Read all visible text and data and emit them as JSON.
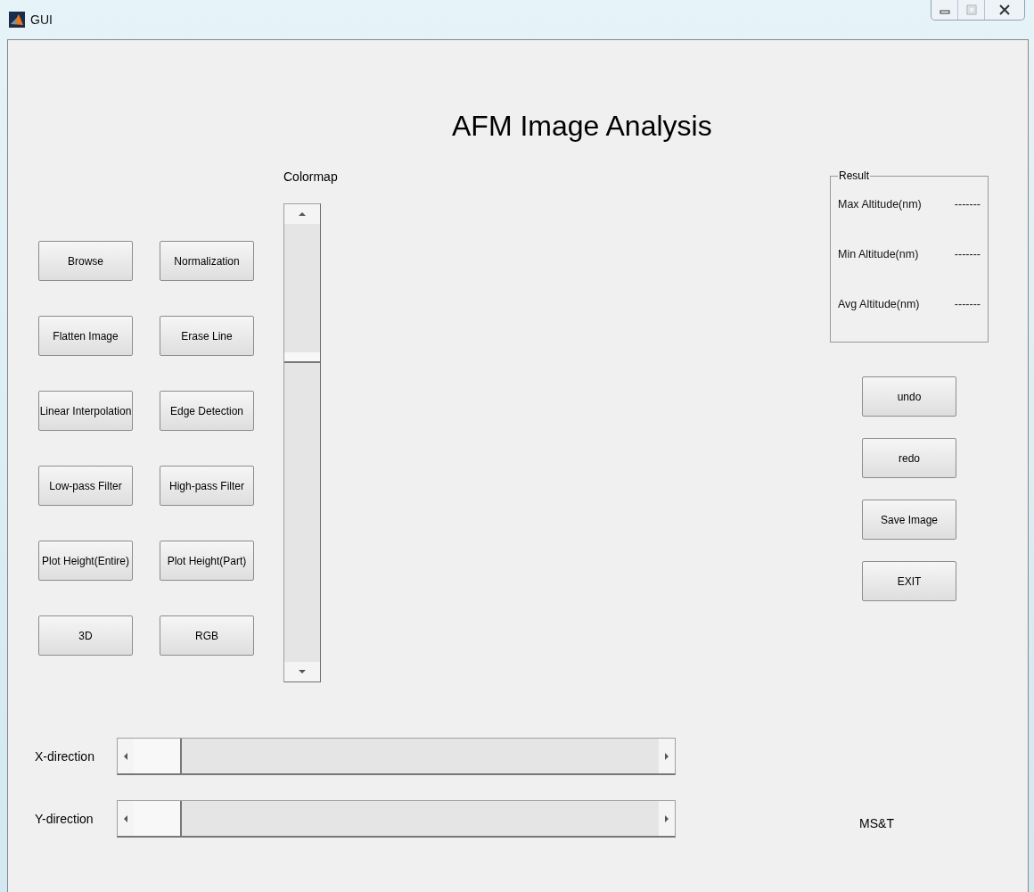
{
  "window": {
    "title": "GUI"
  },
  "heading": "AFM Image Analysis",
  "tool_buttons": [
    {
      "label": "Browse"
    },
    {
      "label": "Normalization"
    },
    {
      "label": "Flatten Image"
    },
    {
      "label": "Erase Line"
    },
    {
      "label": "Linear Interpolation"
    },
    {
      "label": "Edge Detection"
    },
    {
      "label": "Low-pass Filter"
    },
    {
      "label": "High-pass Filter"
    },
    {
      "label": "Plot Height(Entire)"
    },
    {
      "label": "Plot Height(Part)"
    },
    {
      "label": "3D"
    },
    {
      "label": "RGB"
    }
  ],
  "colormap": {
    "label": "Colormap",
    "level": 0.7
  },
  "result": {
    "title": "Result",
    "rows": [
      {
        "label": "Max Altitude(nm)",
        "value": "-------"
      },
      {
        "label": "Min Altitude(nm)",
        "value": "-------"
      },
      {
        "label": "Avg Altitude(nm)",
        "value": "-------"
      }
    ]
  },
  "actions": [
    {
      "label": "undo"
    },
    {
      "label": "redo"
    },
    {
      "label": "Save Image"
    },
    {
      "label": "EXIT"
    }
  ],
  "direction_sliders": [
    {
      "label": "X-direction",
      "level": 0
    },
    {
      "label": "Y-direction",
      "level": 0
    }
  ],
  "footer": "MS&T"
}
